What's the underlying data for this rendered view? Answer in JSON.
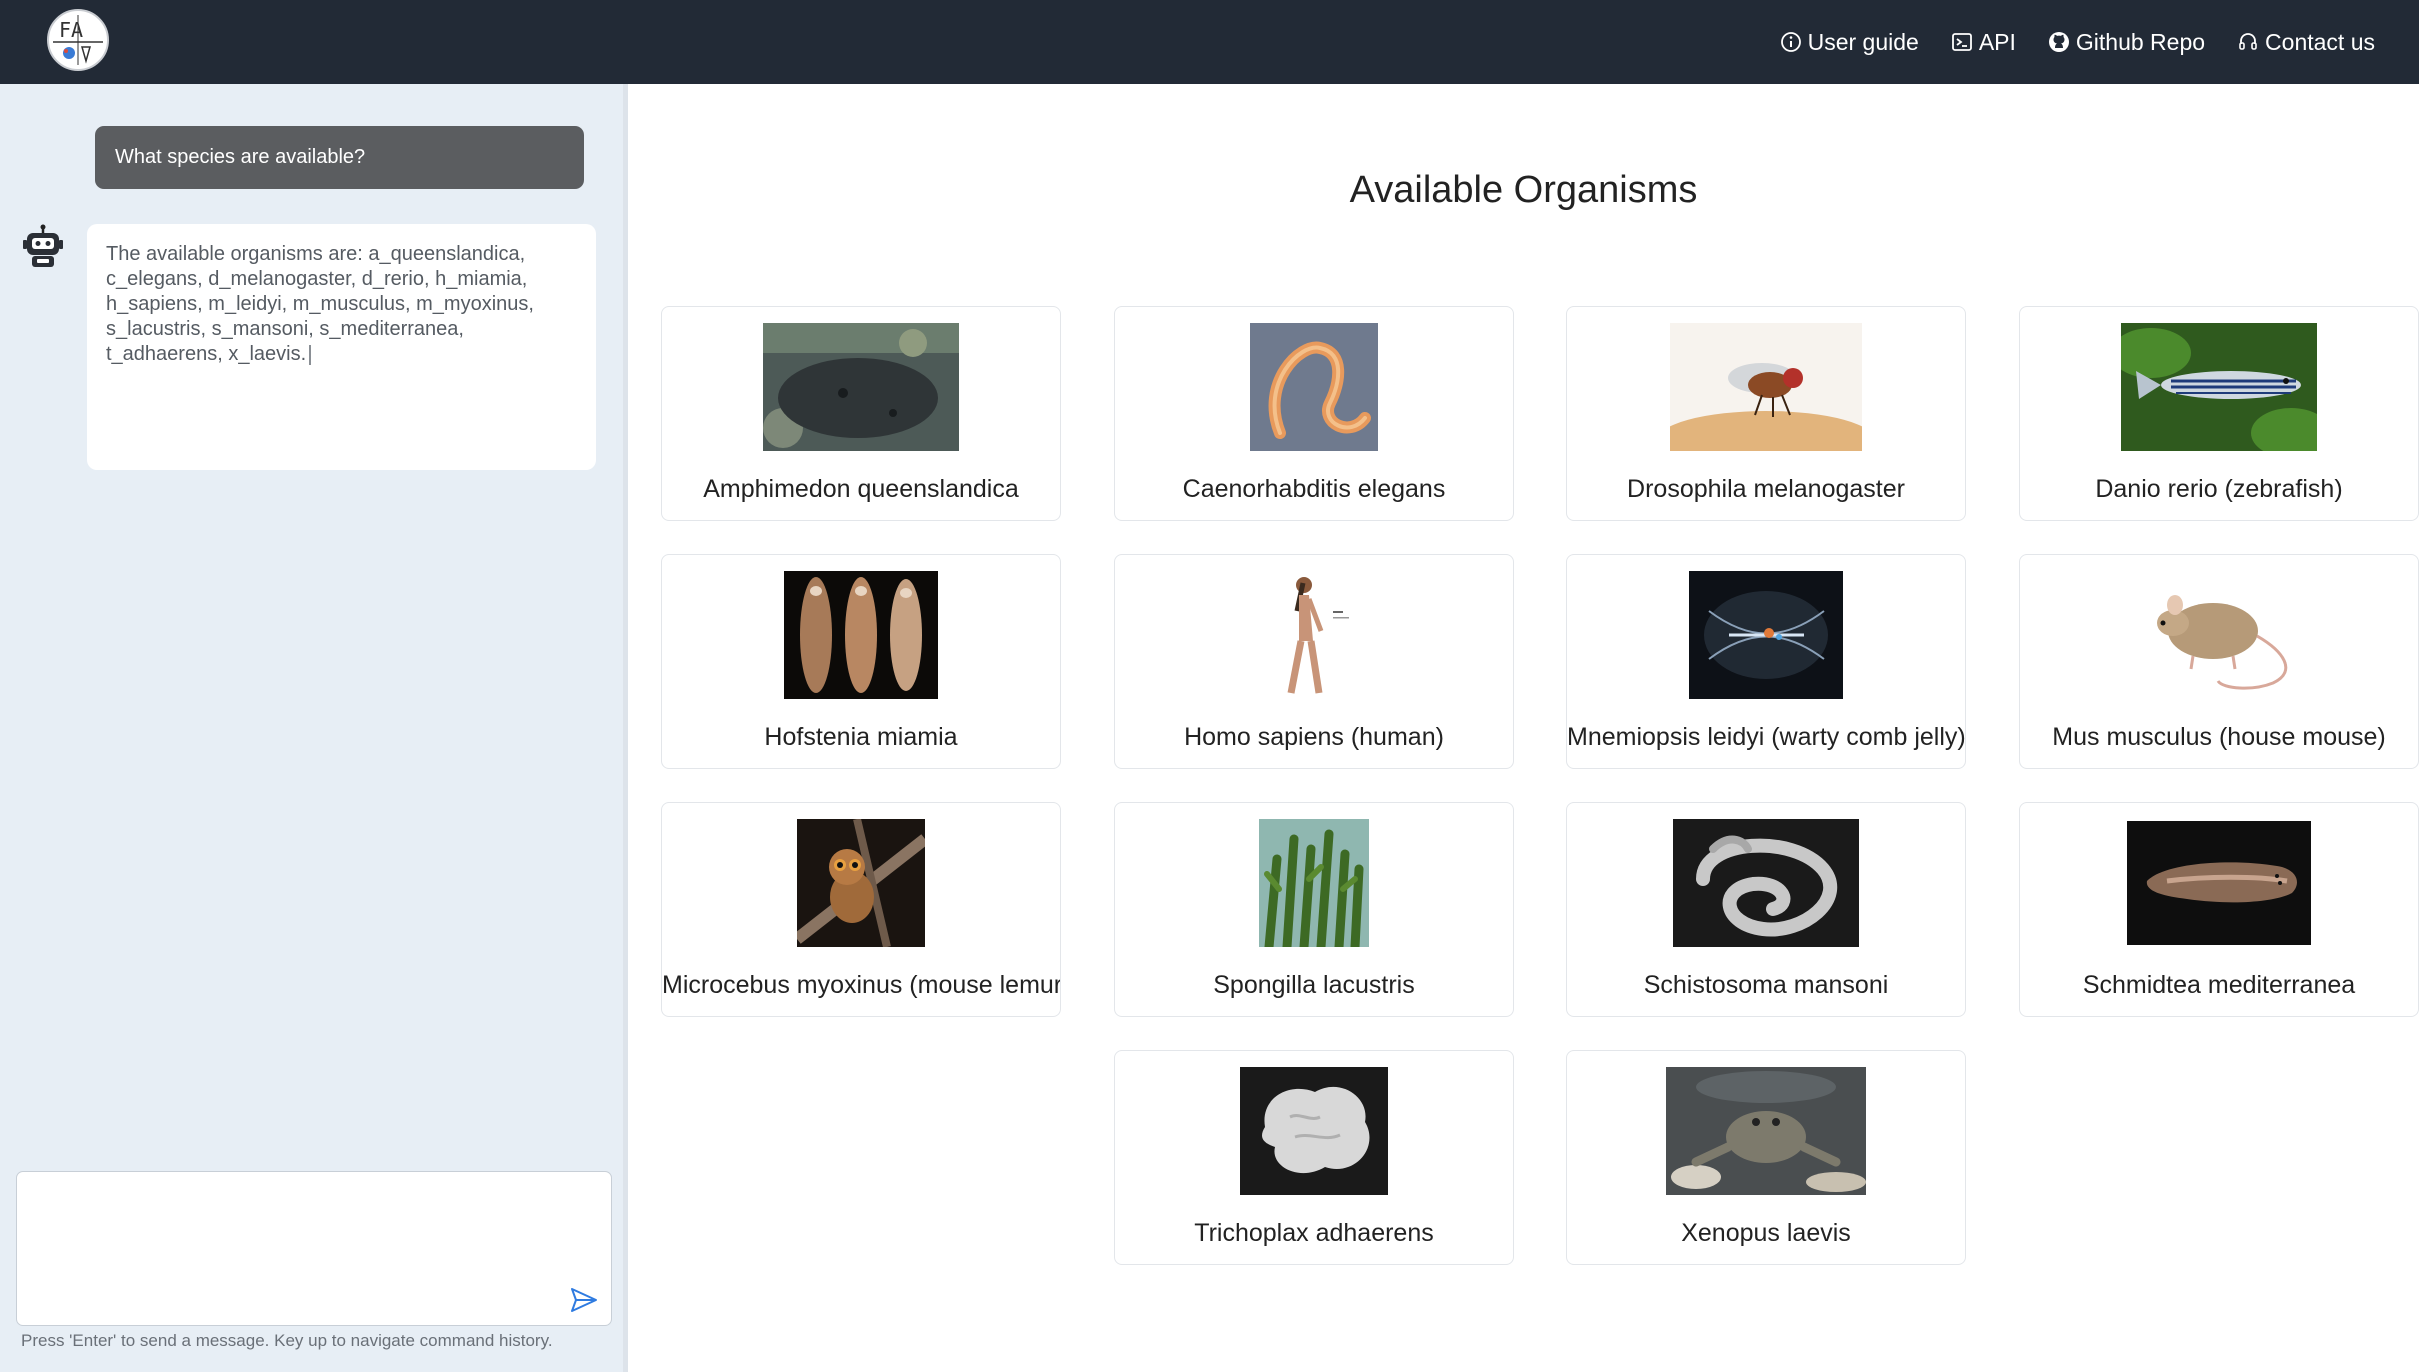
{
  "navbar": {
    "logo_text": "FA",
    "links": [
      {
        "label": "User guide",
        "icon": "info-circle-icon"
      },
      {
        "label": "API",
        "icon": "terminal-icon"
      },
      {
        "label": "Github Repo",
        "icon": "github-icon"
      },
      {
        "label": "Contact us",
        "icon": "headset-icon"
      }
    ]
  },
  "chat": {
    "user_message": "What species are available?",
    "bot_message_lines": [
      "The available organisms are: a_queenslandica,",
      "c_elegans, d_melanogaster, d_rerio, h_miamia,",
      "h_sapiens, m_leidyi, m_musculus, m_myoxinus,",
      "s_lacustris, s_mansoni, s_mediterranea,",
      "t_adhaerens, x_laevis."
    ],
    "input_value": "",
    "hint": "Press 'Enter' to send a message. Key up to navigate command history."
  },
  "main": {
    "title": "Available Organisms",
    "organisms": [
      {
        "name": "Amphimedon queenslandica",
        "image": "sponge-photo"
      },
      {
        "name": "Caenorhabditis elegans",
        "image": "worm-photo"
      },
      {
        "name": "Drosophila melanogaster",
        "image": "fruit-fly-photo"
      },
      {
        "name": "Danio rerio (zebrafish)",
        "image": "zebrafish-photo"
      },
      {
        "name": "Hofstenia miamia",
        "image": "acoel-worms-photo"
      },
      {
        "name": "Homo sapiens (human)",
        "image": "human-figure"
      },
      {
        "name": "Mnemiopsis leidyi (warty comb jelly)",
        "image": "comb-jelly-photo"
      },
      {
        "name": "Mus musculus (house mouse)",
        "image": "mouse-drawing"
      },
      {
        "name": "Microcebus myoxinus (mouse lemur)",
        "image": "mouse-lemur-photo"
      },
      {
        "name": "Spongilla lacustris",
        "image": "freshwater-sponge-photo"
      },
      {
        "name": "Schistosoma mansoni",
        "image": "schistosoma-micrograph"
      },
      {
        "name": "Schmidtea mediterranea",
        "image": "planarian-photo"
      },
      {
        "name": "Trichoplax adhaerens",
        "image": "placozoan-micrograph"
      },
      {
        "name": "Xenopus laevis",
        "image": "frog-photo"
      }
    ]
  }
}
